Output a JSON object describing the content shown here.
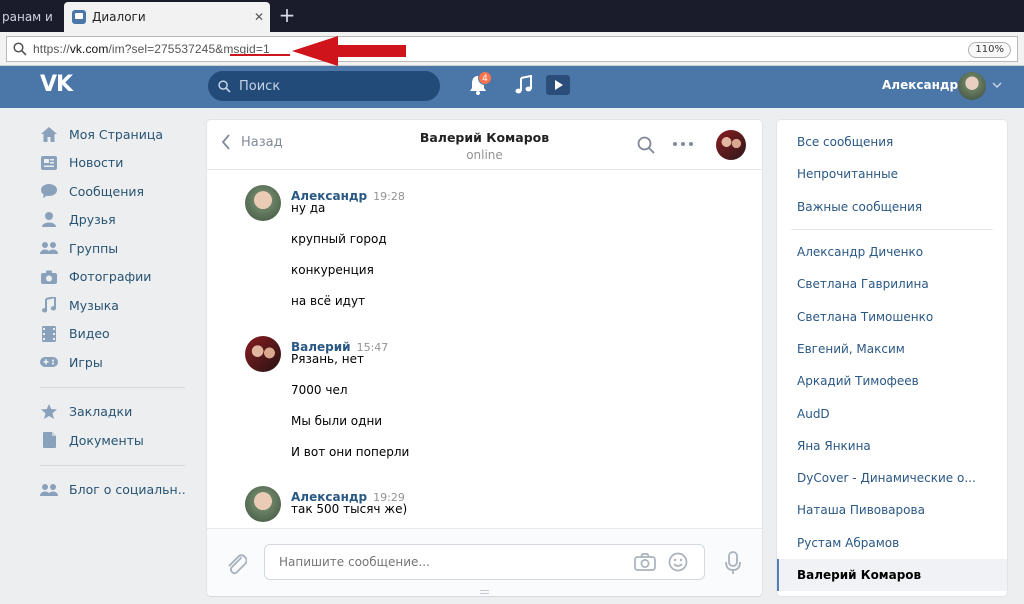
{
  "browser": {
    "prev_tab_label": "ранам и",
    "active_tab_label": "Диалоги",
    "url_prefix": "https://",
    "url_domain": "vk.com",
    "url_rest": "/im?sel=275537245&msgid=1",
    "zoom": "110%"
  },
  "header": {
    "search_placeholder": "Поиск",
    "notifications_count": "4",
    "user_name": "Александр"
  },
  "colors": {
    "brand": "#4a76a8",
    "link": "#2a5885",
    "arrow": "#d0141b"
  },
  "left_nav": {
    "items": [
      {
        "label": "Моя Страница",
        "icon": "home-icon"
      },
      {
        "label": "Новости",
        "icon": "news-icon"
      },
      {
        "label": "Сообщения",
        "icon": "messages-icon"
      },
      {
        "label": "Друзья",
        "icon": "friends-icon"
      },
      {
        "label": "Группы",
        "icon": "groups-icon"
      },
      {
        "label": "Фотографии",
        "icon": "camera-icon"
      },
      {
        "label": "Музыка",
        "icon": "music-icon"
      },
      {
        "label": "Видео",
        "icon": "video-icon"
      },
      {
        "label": "Игры",
        "icon": "gamepad-icon"
      }
    ],
    "secondary": [
      {
        "label": "Закладки",
        "icon": "star-icon"
      },
      {
        "label": "Документы",
        "icon": "document-icon"
      }
    ],
    "tertiary": [
      {
        "label": "Блог о социальн..",
        "icon": "people-icon"
      }
    ]
  },
  "chat": {
    "back_label": "Назад",
    "peer_name": "Валерий Комаров",
    "peer_status": "online",
    "groups": [
      {
        "author": "Александр",
        "time": "19:28",
        "avatar": "a",
        "lines": [
          "ну да",
          "крупный город",
          "конкуренция",
          "на всё идут"
        ]
      },
      {
        "author": "Валерий",
        "time": "15:47",
        "avatar": "v",
        "lines": [
          "Рязань, нет",
          "7000 чел",
          "Мы были одни",
          "И вот они поперли"
        ]
      },
      {
        "author": "Александр",
        "time": "19:29",
        "avatar": "a",
        "lines": [
          "так 500 тысяч же)"
        ]
      }
    ],
    "input_placeholder": "Напишите сообщение..."
  },
  "right_panel": {
    "filters": [
      "Все сообщения",
      "Непрочитанные",
      "Важные сообщения"
    ],
    "dialogs": [
      "Александр Диченко",
      "Светлана Гаврилина",
      "Светлана Тимошенко",
      "Евгений, Максим",
      "Аркадий Тимофеев",
      "AudD",
      "Яна Янкина",
      "DyCover - Динамические о...",
      "Наташа Пивоварова",
      "Рустам Абрамов",
      "Валерий Комаров"
    ],
    "active_dialog": "Валерий Комаров"
  }
}
